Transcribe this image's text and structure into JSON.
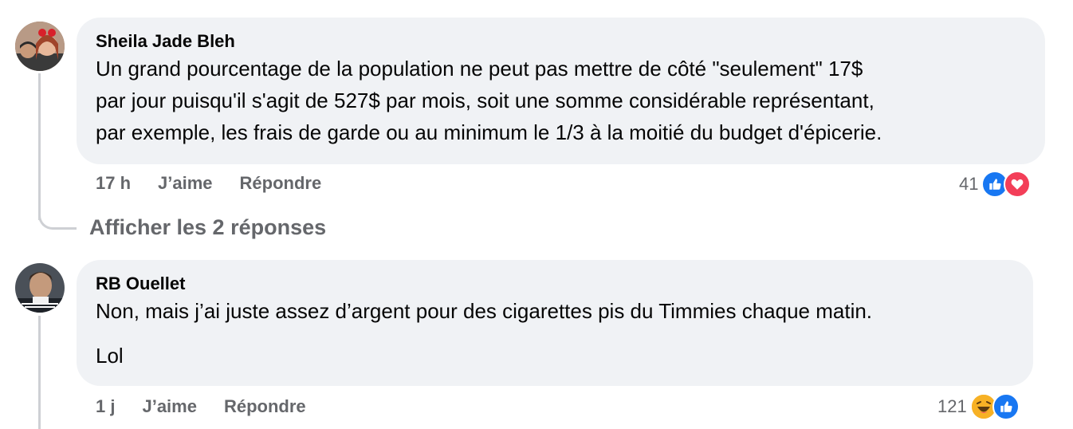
{
  "comments": [
    {
      "author": "Sheila Jade Bleh",
      "lines": [
        "Un grand pourcentage de la population ne peut pas mettre de côté \"seulement\" 17$",
        "par jour puisqu'il s'agit de 527$ par mois, soit une somme considérable représentant,",
        "par exemple, les frais de garde ou au minimum le 1/3 à la moitié du budget d'épicerie."
      ],
      "time": "17 h",
      "like_label": "J’aime",
      "reply_label": "Répondre",
      "reaction_count": "41",
      "reactions": [
        "like-icon",
        "love-icon"
      ]
    },
    {
      "author": "RB Ouellet",
      "lines": [
        "Non, mais j’ai juste assez d’argent pour des cigarettes pis du Timmies chaque matin.",
        "Lol"
      ],
      "time": "1 j",
      "like_label": "J’aime",
      "reply_label": "Répondre",
      "reaction_count": "121",
      "reactions": [
        "haha-icon",
        "like-icon"
      ]
    }
  ],
  "replies_link": "Afficher les 2 réponses",
  "colors": {
    "bubble": "#f0f2f5",
    "meta_text": "#65676b",
    "like_blue": "#1877f2",
    "love_red": "#f33e58",
    "haha_yellow": "#f7b125"
  }
}
